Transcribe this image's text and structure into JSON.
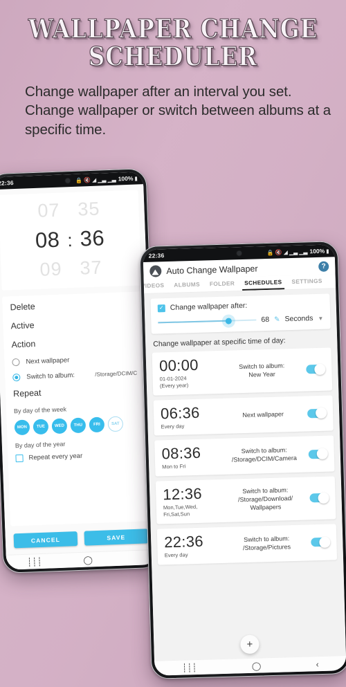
{
  "header": {
    "title_line1": "Wallpaper Change",
    "title_line2": "Scheduler",
    "subtitle": "Change wallpaper after an interval you set. Change wallpaper or switch between albums at a specific time."
  },
  "colors": {
    "accent": "#3cbde8",
    "toggle_on": "#5cc8ea",
    "background_pink": "#cfaac0",
    "background_light": "#e4c5d6",
    "background_teal": "#96d6d6"
  },
  "left_phone": {
    "statusbar": {
      "clock": "22:36",
      "battery": "100%",
      "icons": [
        "lock-icon",
        "mute-icon",
        "wifi-icon",
        "signal-icon",
        "data-icon",
        "signal2-icon",
        "battery-icon"
      ]
    },
    "timepicker": {
      "prev_hour": "07",
      "prev_minute": "35",
      "hour": "08",
      "separator": ":",
      "minute": "36",
      "next_hour": "09",
      "next_minute": "37"
    },
    "delete_label": "Delete",
    "active_label": "Active",
    "action_label": "Action",
    "actions": [
      {
        "label": "Next wallpaper",
        "selected": false,
        "value": ""
      },
      {
        "label": "Switch to album:",
        "selected": true,
        "value": "/Storage/DCIM/C"
      }
    ],
    "repeat_label": "Repeat",
    "by_week_label": "By day of the week",
    "days": [
      {
        "label": "MON",
        "on": true
      },
      {
        "label": "TUE",
        "on": true
      },
      {
        "label": "WED",
        "on": true
      },
      {
        "label": "THU",
        "on": true
      },
      {
        "label": "FRI",
        "on": true
      },
      {
        "label": "SAT",
        "on": false
      }
    ],
    "by_year_label": "By day of the year",
    "repeat_year_label": "Repeat every year",
    "repeat_year_checked": false,
    "cancel_label": "CANCEL",
    "save_label": "SAVE",
    "navbar": [
      "recents-icon",
      "home-icon",
      "back-icon"
    ]
  },
  "right_phone": {
    "statusbar": {
      "clock": "22:36",
      "battery": "100%"
    },
    "app_title": "Auto Change Wallpaper",
    "help_label": "?",
    "tabs": [
      {
        "label": "VIDEOS",
        "active": false
      },
      {
        "label": "ALBUMS",
        "active": false
      },
      {
        "label": "FOLDER",
        "active": false
      },
      {
        "label": "SCHEDULES",
        "active": true
      },
      {
        "label": "SETTINGS",
        "active": false
      }
    ],
    "interval": {
      "checkbox_label": "Change wallpaper after:",
      "checked": true,
      "value": "68",
      "unit": "Seconds",
      "slider_percent": 72
    },
    "section_label": "Change wallpaper at specific time of day:",
    "schedules": [
      {
        "time": "00:00",
        "meta": "01-01-2024\n(Every year)",
        "action": "Switch to album:\nNew Year",
        "enabled": true
      },
      {
        "time": "06:36",
        "meta": "Every day",
        "action": "Next wallpaper",
        "enabled": true
      },
      {
        "time": "08:36",
        "meta": "Mon to Fri",
        "action": "Switch to album:\n/Storage/DCIM/Camera",
        "enabled": true
      },
      {
        "time": "12:36",
        "meta": "Mon,Tue,Wed,\nFri,Sat,Sun",
        "action": "Switch to album:\n/Storage/Download/\nWallpapers",
        "enabled": true
      },
      {
        "time": "22:36",
        "meta": "Every day",
        "action": "Switch to album:\n/Storage/Pictures",
        "enabled": true
      }
    ],
    "fab_label": "+",
    "navbar": [
      "recents-icon",
      "home-icon",
      "back-icon"
    ]
  }
}
